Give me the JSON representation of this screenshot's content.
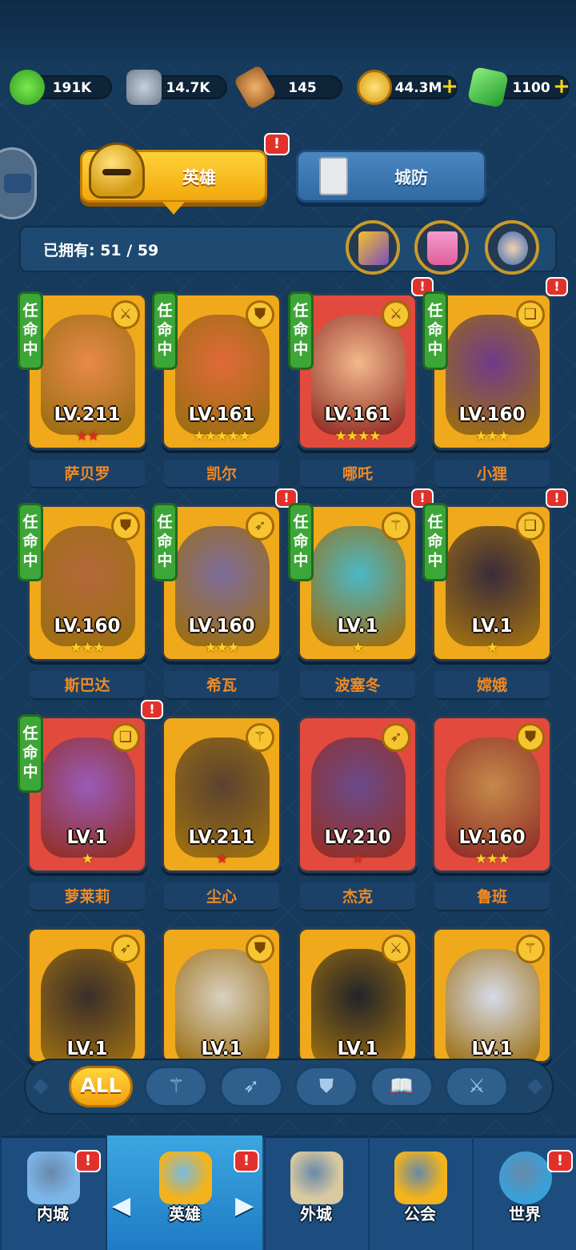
{
  "resources": [
    {
      "name": "exp",
      "value": "191K",
      "color": "#5fd23a"
    },
    {
      "name": "stone",
      "value": "14.7K",
      "color": "#a6b3c4"
    },
    {
      "name": "hammer",
      "value": "145",
      "color": "#d58a3a"
    },
    {
      "name": "gold",
      "value": "44.3M",
      "color": "#f7c52a",
      "plus": "+"
    },
    {
      "name": "gem",
      "value": "1100",
      "color": "#2fc63f",
      "plus": "+"
    }
  ],
  "tabs": {
    "hero": "英雄",
    "defense": "城防",
    "alert": "!"
  },
  "owned": {
    "label": "已拥有: 51 / 59"
  },
  "heroes": [
    {
      "name": "萨贝罗",
      "level": "LV.211",
      "stars": "★★",
      "star_color": "red",
      "status": "任命中",
      "class_icon": "sword",
      "alert": false,
      "bg": "#f0a91b",
      "portrait": "#e8894a"
    },
    {
      "name": "凯尔",
      "level": "LV.161",
      "stars": "★★★★★",
      "star_color": "gold",
      "status": "任命中",
      "class_icon": "shield",
      "alert": false,
      "bg": "#f0a91b",
      "portrait": "#e06a3a"
    },
    {
      "name": "哪吒",
      "level": "LV.161",
      "stars": "★★★★",
      "star_color": "gold",
      "status": "任命中",
      "class_icon": "sword",
      "alert": true,
      "bg": "#e24a3e",
      "portrait": "#f2b98c"
    },
    {
      "name": "小狸",
      "level": "LV.160",
      "stars": "★★★",
      "star_color": "gold",
      "status": "任命中",
      "class_icon": "book",
      "alert": true,
      "bg": "#f0a91b",
      "portrait": "#6f3b8a"
    },
    {
      "name": "斯巴达",
      "level": "LV.160",
      "stars": "★★★",
      "star_color": "gold",
      "status": "任命中",
      "class_icon": "shield",
      "alert": false,
      "bg": "#f0a91b",
      "portrait": "#b5683a"
    },
    {
      "name": "希瓦",
      "level": "LV.160",
      "stars": "★★★",
      "star_color": "gold",
      "status": "任命中",
      "class_icon": "bow",
      "alert": true,
      "bg": "#f0a91b",
      "portrait": "#7d6c9c"
    },
    {
      "name": "波塞冬",
      "level": "LV.1",
      "stars": "★",
      "star_color": "gold",
      "status": "任命中",
      "class_icon": "staff",
      "alert": true,
      "bg": "#f0a91b",
      "portrait": "#4ab9c6"
    },
    {
      "name": "嫦娥",
      "level": "LV.1",
      "stars": "★",
      "star_color": "gold",
      "status": "任命中",
      "class_icon": "book",
      "alert": true,
      "bg": "#f0a91b",
      "portrait": "#3a2b3a"
    },
    {
      "name": "萝莱莉",
      "level": "LV.1",
      "stars": "★",
      "star_color": "gold",
      "status": "任命中",
      "class_icon": "book",
      "alert": true,
      "bg": "#e24a3e",
      "portrait": "#9a5ab8"
    },
    {
      "name": "尘心",
      "level": "LV.211",
      "stars": "★",
      "star_color": "red",
      "status": "",
      "class_icon": "staff",
      "alert": false,
      "bg": "#f0a91b",
      "portrait": "#5a4230"
    },
    {
      "name": "杰克",
      "level": "LV.210",
      "stars": "★",
      "star_color": "red",
      "status": "",
      "class_icon": "bow",
      "alert": false,
      "bg": "#e24a3e",
      "portrait": "#6a4a8a"
    },
    {
      "name": "鲁班",
      "level": "LV.160",
      "stars": "★★★",
      "star_color": "gold",
      "status": "",
      "class_icon": "shield",
      "alert": false,
      "bg": "#e24a3e",
      "portrait": "#c48a4a"
    },
    {
      "name": "",
      "level": "LV.1",
      "stars": "",
      "star_color": "gold",
      "status": "",
      "class_icon": "bow",
      "alert": false,
      "bg": "#f0a91b",
      "portrait": "#3a2e2a"
    },
    {
      "name": "",
      "level": "LV.1",
      "stars": "",
      "star_color": "gold",
      "status": "",
      "class_icon": "shield",
      "alert": false,
      "bg": "#f0a91b",
      "portrait": "#d8d0c0"
    },
    {
      "name": "",
      "level": "LV.1",
      "stars": "",
      "star_color": "gold",
      "status": "",
      "class_icon": "sword",
      "alert": false,
      "bg": "#f0a91b",
      "portrait": "#222428"
    },
    {
      "name": "",
      "level": "LV.1",
      "stars": "",
      "star_color": "gold",
      "status": "",
      "class_icon": "staff",
      "alert": false,
      "bg": "#f0a91b",
      "portrait": "#d6dbe8"
    }
  ],
  "filters": [
    {
      "name": "all",
      "label": "ALL",
      "active": true
    },
    {
      "name": "staff",
      "label": "⚚",
      "active": false
    },
    {
      "name": "bow",
      "label": "➶",
      "active": false
    },
    {
      "name": "shield",
      "label": "⛊",
      "active": false
    },
    {
      "name": "book",
      "label": "📖",
      "active": false
    },
    {
      "name": "sword",
      "label": "⚔",
      "active": false
    }
  ],
  "nav": [
    {
      "name": "inner-city",
      "label": "内城",
      "alert": true,
      "color": "#7cb5e8"
    },
    {
      "name": "hero",
      "label": "英雄",
      "alert": true,
      "active": true,
      "color": "#f2b31c"
    },
    {
      "name": "outer-city",
      "label": "外城",
      "alert": false,
      "color": "#d8c9a0"
    },
    {
      "name": "guild",
      "label": "公会",
      "alert": false,
      "color": "#f2b31c"
    },
    {
      "name": "world",
      "label": "世界",
      "alert": true,
      "color": "#3aa0d8"
    }
  ],
  "nav_arrows": {
    "left": "◀",
    "right": "▶"
  }
}
